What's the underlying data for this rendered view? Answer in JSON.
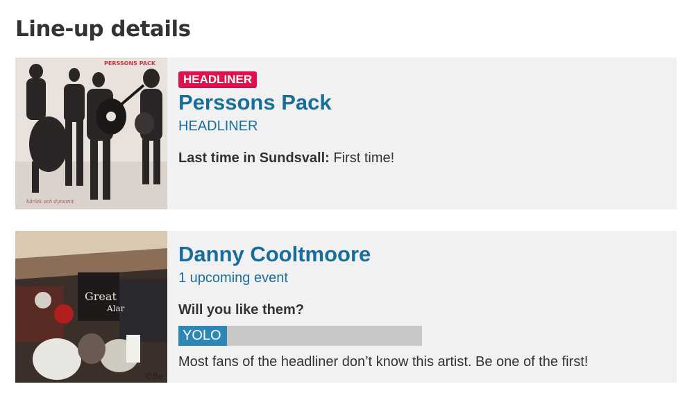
{
  "page": {
    "title": "Line-up details"
  },
  "colors": {
    "accent": "#176e9b",
    "badge": "#e0104d",
    "card_bg": "#f1f1f1",
    "bar_fill": "#2c87b6",
    "bar_track": "#c8c8c8"
  },
  "artists": [
    {
      "badge": "HEADLINER",
      "name": "Perssons Pack",
      "subline": "HEADLINER",
      "meta_label": "Last time in Sundsvall:",
      "meta_value": "First time!",
      "image": {
        "name": "perssons-pack-album-cover",
        "text_top": "PERSSONS PACK",
        "text_bottom": "kärlek och dynamit"
      }
    },
    {
      "name": "Danny Cooltmoore",
      "subline": "1 upcoming event",
      "question": "Will you like them?",
      "rating": {
        "label": "YOLO",
        "fraction": 0.2
      },
      "note": "Most fans of the headliner don’t know this artist. Be one of the first!",
      "image": {
        "name": "danny-cooltmoore-photo",
        "text_sign_1": "Great",
        "text_sign_2": "Alar",
        "text_corner": "©Be"
      }
    }
  ]
}
